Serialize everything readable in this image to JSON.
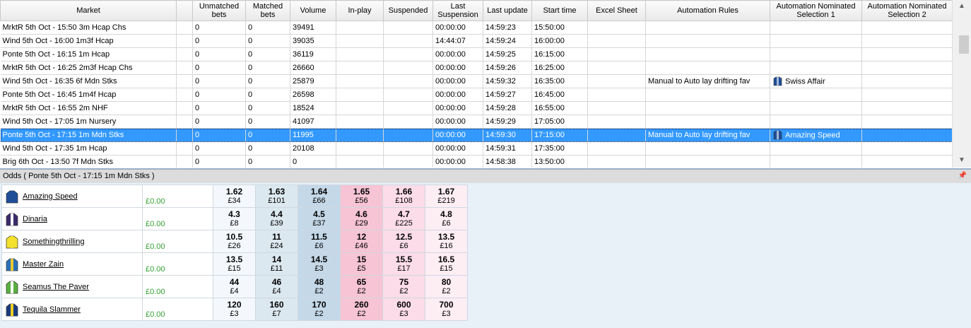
{
  "columns": [
    "Market",
    "",
    "Unmatched bets",
    "Matched bets",
    "Volume",
    "In-play",
    "Suspended",
    "Last Suspension",
    "Last update",
    "Start time",
    "Excel Sheet",
    "Automation Rules",
    "Automation Nominated Selection 1",
    "Automation Nominated Selection 2"
  ],
  "markets": [
    {
      "market": "MrktR 5th Oct - 15:50 3m Hcap Chs",
      "unmatched": "0",
      "matched": "0",
      "volume": "39491",
      "inplay": "",
      "suspended": "",
      "last_susp": "00:00:00",
      "last_update": "14:59:23",
      "start": "15:50:00",
      "excel": "",
      "rule": "",
      "sel1": "",
      "sel2": ""
    },
    {
      "market": "Wind 5th Oct - 16:00 1m3f Hcap",
      "unmatched": "0",
      "matched": "0",
      "volume": "39035",
      "inplay": "",
      "suspended": "",
      "last_susp": "14:44:07",
      "last_update": "14:59:24",
      "start": "16:00:00",
      "excel": "",
      "rule": "",
      "sel1": "",
      "sel2": ""
    },
    {
      "market": "Ponte 5th Oct - 16:15 1m Hcap",
      "unmatched": "0",
      "matched": "0",
      "volume": "36119",
      "inplay": "",
      "suspended": "",
      "last_susp": "00:00:00",
      "last_update": "14:59:25",
      "start": "16:15:00",
      "excel": "",
      "rule": "",
      "sel1": "",
      "sel2": ""
    },
    {
      "market": "MrktR 5th Oct - 16:25 2m3f Hcap Chs",
      "unmatched": "0",
      "matched": "0",
      "volume": "26660",
      "inplay": "",
      "suspended": "",
      "last_susp": "00:00:00",
      "last_update": "14:59:26",
      "start": "16:25:00",
      "excel": "",
      "rule": "",
      "sel1": "",
      "sel2": ""
    },
    {
      "market": "Wind 5th Oct - 16:35 6f Mdn Stks",
      "unmatched": "0",
      "matched": "0",
      "volume": "25879",
      "inplay": "",
      "suspended": "",
      "last_susp": "00:00:00",
      "last_update": "14:59:32",
      "start": "16:35:00",
      "excel": "",
      "rule": "Manual to Auto lay drifting fav",
      "sel1": "Swiss Affair",
      "sel2": ""
    },
    {
      "market": "Ponte 5th Oct - 16:45 1m4f Hcap",
      "unmatched": "0",
      "matched": "0",
      "volume": "26598",
      "inplay": "",
      "suspended": "",
      "last_susp": "00:00:00",
      "last_update": "14:59:27",
      "start": "16:45:00",
      "excel": "",
      "rule": "",
      "sel1": "",
      "sel2": ""
    },
    {
      "market": "MrktR 5th Oct - 16:55 2m NHF",
      "unmatched": "0",
      "matched": "0",
      "volume": "18524",
      "inplay": "",
      "suspended": "",
      "last_susp": "00:00:00",
      "last_update": "14:59:28",
      "start": "16:55:00",
      "excel": "",
      "rule": "",
      "sel1": "",
      "sel2": ""
    },
    {
      "market": "Wind 5th Oct - 17:05 1m Nursery",
      "unmatched": "0",
      "matched": "0",
      "volume": "41097",
      "inplay": "",
      "suspended": "",
      "last_susp": "00:00:00",
      "last_update": "14:59:29",
      "start": "17:05:00",
      "excel": "",
      "rule": "",
      "sel1": "",
      "sel2": ""
    },
    {
      "market": "Ponte 5th Oct - 17:15 1m Mdn Stks",
      "unmatched": "0",
      "matched": "0",
      "volume": "11995",
      "inplay": "",
      "suspended": "",
      "last_susp": "00:00:00",
      "last_update": "14:59:30",
      "start": "17:15:00",
      "excel": "",
      "rule": "Manual to Auto lay drifting fav",
      "sel1": "Amazing Speed",
      "sel2": ""
    },
    {
      "market": "Wind 5th Oct - 17:35 1m Hcap",
      "unmatched": "0",
      "matched": "0",
      "volume": "20108",
      "inplay": "",
      "suspended": "",
      "last_susp": "00:00:00",
      "last_update": "14:59:31",
      "start": "17:35:00",
      "excel": "",
      "rule": "",
      "sel1": "",
      "sel2": ""
    },
    {
      "market": "Brig 6th Oct - 13:50 7f Mdn Stks",
      "unmatched": "0",
      "matched": "0",
      "volume": "0",
      "inplay": "",
      "suspended": "",
      "last_susp": "00:00:00",
      "last_update": "14:58:38",
      "start": "13:50:00",
      "excel": "",
      "rule": "",
      "sel1": "",
      "sel2": ""
    }
  ],
  "selected_row": 8,
  "scroll": {
    "up": "▲",
    "down": "▼"
  },
  "odds_panel": {
    "title": "Odds ( Ponte 5th Oct - 17:15 1m Mdn Stks )",
    "pin": "📌",
    "runners": [
      {
        "name": "Amazing Speed",
        "pl": "£0.00",
        "silk_colors": [
          "#1f4e99",
          "#1f4e99"
        ],
        "prices": [
          [
            "1.62",
            "£34"
          ],
          [
            "1.63",
            "£101"
          ],
          [
            "1.64",
            "£66"
          ],
          [
            "1.65",
            "£56"
          ],
          [
            "1.66",
            "£108"
          ],
          [
            "1.67",
            "£219"
          ]
        ]
      },
      {
        "name": "Dinaria",
        "pl": "£0.00",
        "silk_colors": [
          "#3a2a6a",
          "#ffffff"
        ],
        "prices": [
          [
            "4.3",
            "£8"
          ],
          [
            "4.4",
            "£39"
          ],
          [
            "4.5",
            "£37"
          ],
          [
            "4.6",
            "£29"
          ],
          [
            "4.7",
            "£225"
          ],
          [
            "4.8",
            "£6"
          ]
        ]
      },
      {
        "name": "Somethingthrilling",
        "pl": "£0.00",
        "silk_colors": [
          "#f2e02a",
          "#f2e02a"
        ],
        "prices": [
          [
            "10.5",
            "£26"
          ],
          [
            "11",
            "£24"
          ],
          [
            "11.5",
            "£6"
          ],
          [
            "12",
            "£46"
          ],
          [
            "12.5",
            "£6"
          ],
          [
            "13.5",
            "£16"
          ]
        ]
      },
      {
        "name": "Master Zain",
        "pl": "£0.00",
        "silk_colors": [
          "#2a70b8",
          "#e8c830"
        ],
        "prices": [
          [
            "13.5",
            "£15"
          ],
          [
            "14",
            "£11"
          ],
          [
            "14.5",
            "£3"
          ],
          [
            "15",
            "£5"
          ],
          [
            "15.5",
            "£17"
          ],
          [
            "16.5",
            "£15"
          ]
        ]
      },
      {
        "name": "Seamus The Paver",
        "pl": "£0.00",
        "silk_colors": [
          "#58b040",
          "#ffffff"
        ],
        "prices": [
          [
            "44",
            "£4"
          ],
          [
            "46",
            "£4"
          ],
          [
            "48",
            "£2"
          ],
          [
            "65",
            "£2"
          ],
          [
            "75",
            "£2"
          ],
          [
            "80",
            "£2"
          ]
        ]
      },
      {
        "name": "Tequila Slammer",
        "pl": "£0.00",
        "silk_colors": [
          "#1a3a80",
          "#f0d020"
        ],
        "prices": [
          [
            "120",
            "£3"
          ],
          [
            "160",
            "£7"
          ],
          [
            "170",
            "£2"
          ],
          [
            "260",
            "£2"
          ],
          [
            "600",
            "£3"
          ],
          [
            "700",
            "£3"
          ]
        ]
      }
    ]
  }
}
